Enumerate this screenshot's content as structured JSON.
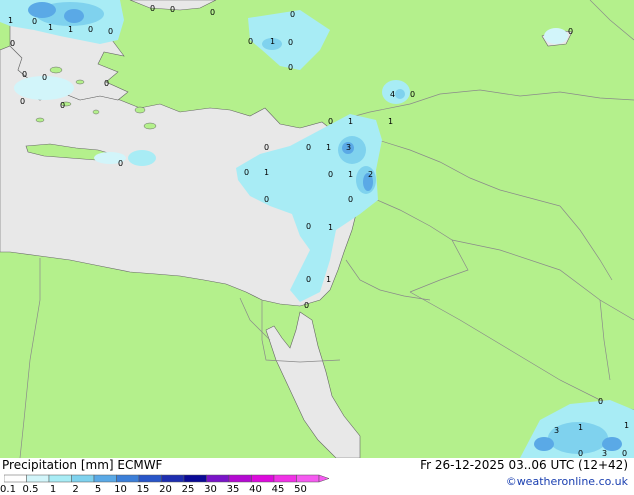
{
  "title_left": "Precipitation [mm]  ECMWF",
  "title_right": "Fr 26-12-2025 03..06 UTC (12+42)",
  "credit": "©weatheronline.co.uk",
  "colors": {
    "land": "#b4f08c",
    "sea": "#e8e8e8",
    "border": "#8a8a8a",
    "coast": "#666666",
    "precip_light": "#a8ecf5",
    "precip_mid": "#7fd2ee",
    "precip_heavy": "#5aa9e6"
  },
  "legend": {
    "ticks": [
      "0.1",
      "0.5",
      "1",
      "2",
      "5",
      "10",
      "15",
      "20",
      "25",
      "30",
      "35",
      "40",
      "45",
      "50"
    ],
    "colors": [
      "#fefefe",
      "#d2f5fa",
      "#a8ecf5",
      "#7fd2ee",
      "#5aa9e6",
      "#3c7fd8",
      "#2855c8",
      "#1e2eb0",
      "#0a0a96",
      "#7a14c8",
      "#b40ad2",
      "#dc0adc",
      "#f032e6",
      "#f55af0"
    ]
  },
  "map_labels": [
    {
      "text": "1",
      "place": "Aegean NW"
    },
    {
      "text": "0",
      "place": "Aegean N"
    },
    {
      "text": "1",
      "place": "Aegean N"
    },
    {
      "text": "1",
      "place": "Aegean N"
    },
    {
      "text": "0",
      "place": "Aegean N"
    },
    {
      "text": "0",
      "place": "Aegean N"
    },
    {
      "text": "0",
      "place": "Black Sea coast"
    },
    {
      "text": "0",
      "place": "Turkey"
    },
    {
      "text": "0",
      "place": "Turkey"
    },
    {
      "text": "0",
      "place": "Turkey"
    },
    {
      "text": "0",
      "place": "Turkey central"
    },
    {
      "text": "1",
      "place": "Turkey central"
    },
    {
      "text": "0",
      "place": "Turkey central"
    },
    {
      "text": "0",
      "place": "Turkey central"
    },
    {
      "text": "0",
      "place": "Caspian W"
    },
    {
      "text": "0",
      "place": "Aegean S"
    },
    {
      "text": "0",
      "place": "Aegean S"
    },
    {
      "text": "0",
      "place": "Aegean S"
    },
    {
      "text": "0",
      "place": "Aegean S"
    },
    {
      "text": "0",
      "place": "Aegean S"
    },
    {
      "text": "0",
      "place": "Aegean S"
    },
    {
      "text": "0",
      "place": "Crete S"
    },
    {
      "text": "4",
      "place": "SE Turkey"
    },
    {
      "text": "0",
      "place": "SE Turkey"
    },
    {
      "text": "1",
      "place": "Syria coast"
    },
    {
      "text": "0",
      "place": "Levant N"
    },
    {
      "text": "1",
      "place": "Levant N"
    },
    {
      "text": "0",
      "place": "Cyprus W"
    },
    {
      "text": "0",
      "place": "Cyprus E"
    },
    {
      "text": "1",
      "place": "Cyprus E"
    },
    {
      "text": "3",
      "place": "Lebanon"
    },
    {
      "text": "0",
      "place": "Cyprus"
    },
    {
      "text": "1",
      "place": "Cyprus"
    },
    {
      "text": "0",
      "place": "Levant coast"
    },
    {
      "text": "1",
      "place": "Levant coast"
    },
    {
      "text": "2",
      "place": "Lebanon"
    },
    {
      "text": "0",
      "place": "Cyprus S"
    },
    {
      "text": "0",
      "place": "Israel coast"
    },
    {
      "text": "0",
      "place": "Sea S"
    },
    {
      "text": "1",
      "place": "Sea S"
    },
    {
      "text": "0",
      "place": "Sinai coast"
    },
    {
      "text": "1",
      "place": "Sinai coast"
    },
    {
      "text": "0",
      "place": "Sinai"
    },
    {
      "text": "0",
      "place": "Arabia SE"
    },
    {
      "text": "3",
      "place": "Arabia SE"
    },
    {
      "text": "1",
      "place": "Arabia SE"
    },
    {
      "text": "1",
      "place": "Arabia SE"
    },
    {
      "text": "0",
      "place": "Arabia SE"
    },
    {
      "text": "3",
      "place": "Arabia SE"
    },
    {
      "text": "0",
      "place": "Arabia SE"
    }
  ]
}
